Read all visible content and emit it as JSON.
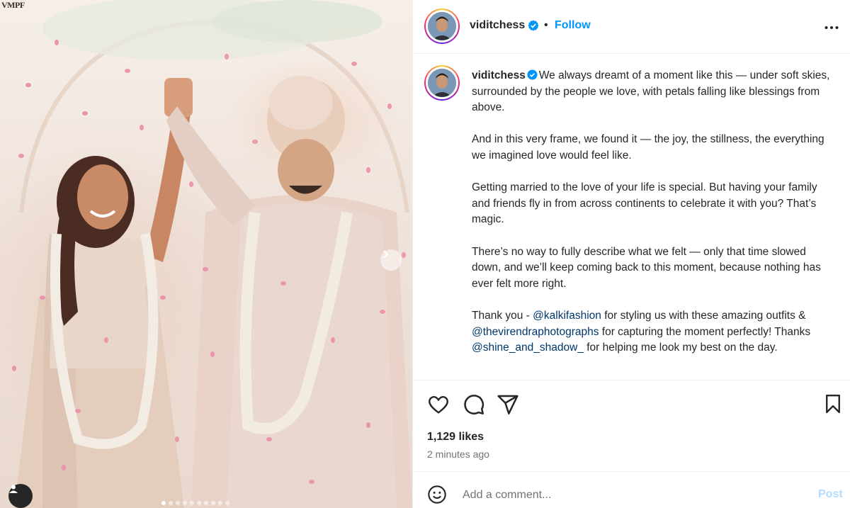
{
  "photo": {
    "watermark": "VMPF",
    "alt_description": "",
    "next_icon": "chevron-right-icon",
    "tag_icon": "user-tag-icon",
    "carousel_count": 10,
    "carousel_active_index": 0
  },
  "header": {
    "username": "viditchess",
    "verified": true,
    "separator": "•",
    "follow_label": "Follow",
    "more_icon": "more-horizontal-icon"
  },
  "caption": {
    "username": "viditchess",
    "paragraphs": [
      [
        {
          "t": "We always dreamt of a moment like this — under soft skies, surrounded by the people we love, with petals falling like blessings from above."
        }
      ],
      [
        {
          "t": "And in this very frame, we found it — the joy, the stillness, the everything we imagined love would feel like."
        }
      ],
      [
        {
          "t": "Getting married to the love of your life is special. But having your family and friends fly in from across continents to celebrate it with you? That’s magic."
        }
      ],
      [
        {
          "t": "There’s no way to fully describe what we felt — only that time slowed down, and we’ll keep coming back to this moment, because nothing has ever felt more right."
        }
      ],
      [
        {
          "t": "Thank you - "
        },
        {
          "m": "@kalkifashion"
        },
        {
          "t": " for styling us with these amazing outfits & "
        },
        {
          "m": "@thevirendraphotographs"
        },
        {
          "t": " for capturing the moment perfectly! Thanks "
        },
        {
          "m": "@shine_and_shadow_"
        },
        {
          "t": " for helping me look my best on the day."
        }
      ]
    ]
  },
  "actions": {
    "like_icon": "heart-icon",
    "comment_icon": "comment-icon",
    "share_icon": "send-icon",
    "save_icon": "bookmark-icon",
    "likes": "1,129 likes",
    "timestamp": "2 minutes ago"
  },
  "comment_bar": {
    "emoji_icon": "emoji-icon",
    "placeholder": "Add a comment...",
    "post_label": "Post"
  },
  "colors": {
    "accent": "#0095f6",
    "mention": "#00376b",
    "post_disabled": "#b3dbff",
    "muted": "#737373"
  }
}
